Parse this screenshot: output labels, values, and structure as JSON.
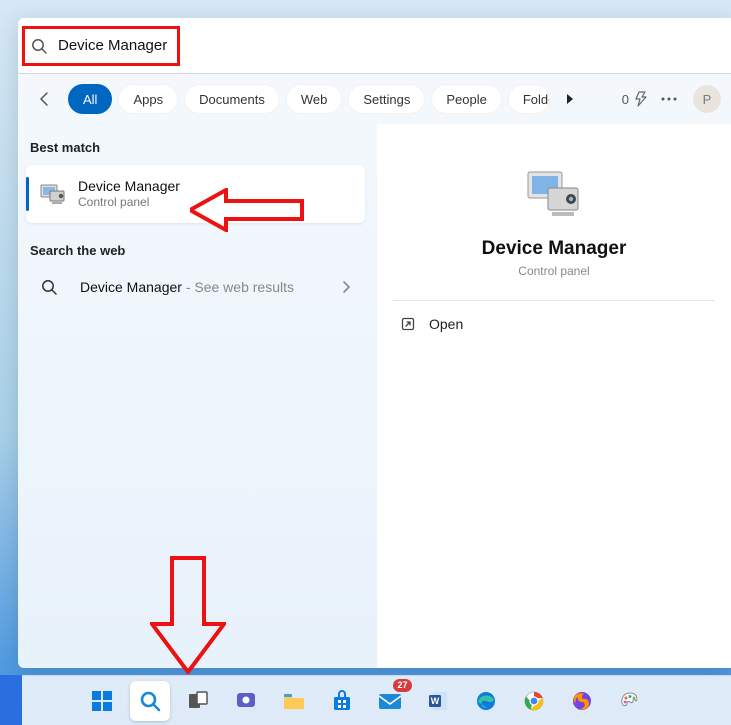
{
  "search": {
    "value": "Device Manager"
  },
  "filters": {
    "all": "All",
    "apps": "Apps",
    "documents": "Documents",
    "web": "Web",
    "settings": "Settings",
    "people": "People",
    "folders": "Folders"
  },
  "topRight": {
    "energy": "0",
    "avatar": "P"
  },
  "left": {
    "bestMatch": "Best match",
    "result": {
      "title": "Device Manager",
      "subtitle": "Control panel"
    },
    "searchWeb": "Search the web",
    "webResult": {
      "query": "Device Manager",
      "hint": " - See web results"
    }
  },
  "detail": {
    "title": "Device Manager",
    "subtitle": "Control panel",
    "open": "Open"
  }
}
